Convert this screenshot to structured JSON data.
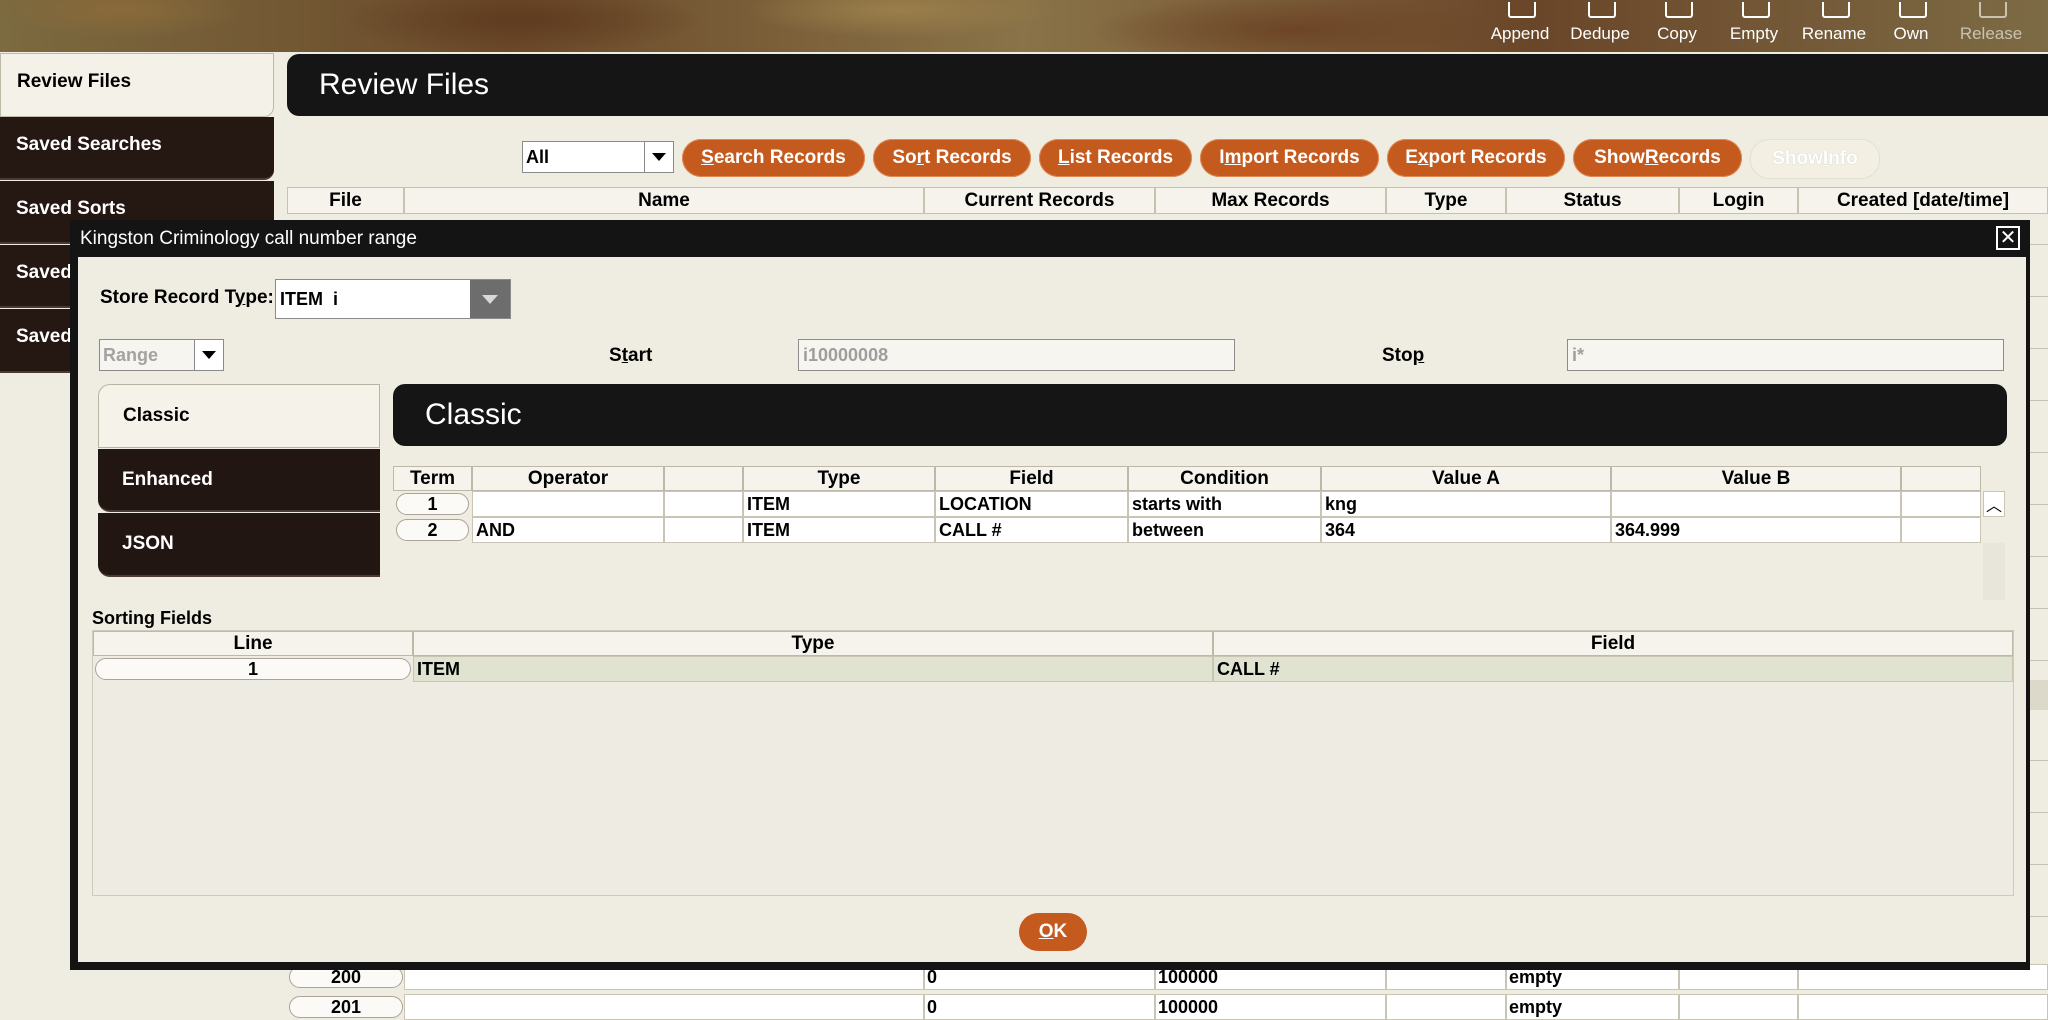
{
  "toolbar": {
    "items": [
      {
        "label": "Append",
        "icon": "append-icon"
      },
      {
        "label": "Dedupe",
        "icon": "dedupe-icon"
      },
      {
        "label": "Copy",
        "icon": "copy-icon"
      },
      {
        "label": "Empty",
        "icon": "empty-icon"
      },
      {
        "label": "Rename",
        "icon": "rename-icon"
      },
      {
        "label": "Own",
        "icon": "own-icon"
      },
      {
        "label": "Release",
        "icon": "release-icon",
        "disabled": true
      }
    ]
  },
  "sidebar": {
    "items": [
      {
        "label": "Review Files",
        "active": true
      },
      {
        "label": "Saved Searches"
      },
      {
        "label": "Saved Sorts"
      },
      {
        "label": "Saved"
      },
      {
        "label": "Saved"
      }
    ]
  },
  "review": {
    "title": "Review Files",
    "filter_value": "All",
    "buttons": {
      "search": {
        "pre": "",
        "u": "S",
        "post": "earch Records"
      },
      "sort": {
        "pre": "So",
        "u": "r",
        "post": "t Records"
      },
      "list": {
        "pre": "",
        "u": "L",
        "post": "ist Records"
      },
      "import": {
        "pre": "I",
        "u": "m",
        "post": "port Records"
      },
      "export": {
        "pre": "E",
        "u": "x",
        "post": "port Records"
      },
      "show": {
        "pre": "Show ",
        "u": "R",
        "post": "ecords"
      },
      "info": {
        "pre": "Show ",
        "u": "I",
        "post": "nfo"
      }
    },
    "columns": [
      "File",
      "Name",
      "Current Records",
      "Max Records",
      "Type",
      "Status",
      "Login",
      "Created [date/time]"
    ],
    "rows": [
      {
        "file": "200",
        "current": "0",
        "max": "100000",
        "status": "empty"
      },
      {
        "file": "201",
        "current": "0",
        "max": "100000",
        "status": "empty"
      }
    ]
  },
  "dialog": {
    "title": "Kingston Criminology call number range",
    "store_record_type_label": {
      "pre": "Store Record T",
      "u": "y",
      "post": "pe:"
    },
    "store_record_type_value": "ITEM  i",
    "range_value": "Range",
    "start_label": {
      "pre": "S",
      "u": "t",
      "post": "art"
    },
    "start_value": "i10000008",
    "stop_label": {
      "pre": "Sto",
      "u": "p",
      "post": ""
    },
    "stop_value": "i*",
    "tabs": [
      "Classic",
      "Enhanced",
      "JSON"
    ],
    "panel_title": "Classic",
    "query_columns": [
      "Term",
      "Operator",
      "",
      "Type",
      "Field",
      "Condition",
      "Value A",
      "Value B",
      ""
    ],
    "query_rows": [
      {
        "term": "1",
        "operator": "",
        "type": "ITEM",
        "field": "LOCATION",
        "condition": "starts with",
        "value_a": "kng",
        "value_b": ""
      },
      {
        "term": "2",
        "operator": "AND",
        "type": "ITEM",
        "field": "CALL #",
        "condition": "between",
        "value_a": "364",
        "value_b": "364.999"
      }
    ],
    "sorting": {
      "title": "Sorting Fields",
      "columns": [
        "Line",
        "Type",
        "Field"
      ],
      "rows": [
        {
          "line": "1",
          "type": "ITEM",
          "field": "CALL #"
        }
      ]
    },
    "ok": {
      "u": "O",
      "post": "K"
    }
  }
}
